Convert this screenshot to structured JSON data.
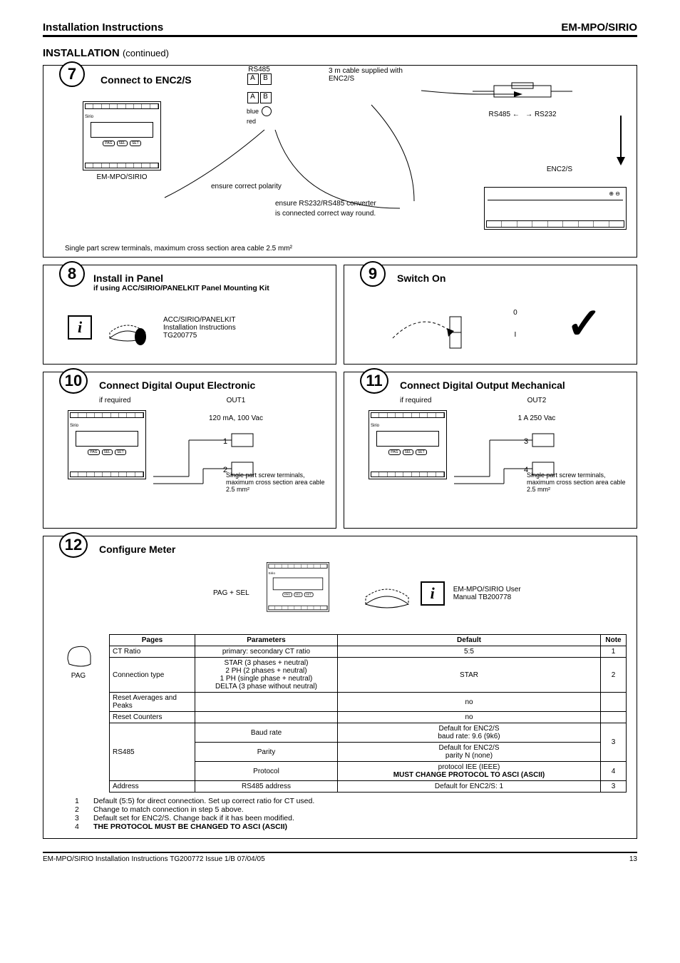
{
  "header": {
    "left": "Installation Instructions",
    "right": "EM-MPO/SIRIO"
  },
  "section": {
    "title": "INSTALLATION",
    "continued": "(continued)"
  },
  "step7": {
    "num": "7",
    "title": "Connect to ENC2/S",
    "rs485": "RS485",
    "a": "A",
    "b": "B",
    "cable": "3 m cable supplied with ENC2/S",
    "blue": "blue",
    "red": "red",
    "polarity": "ensure correct polarity",
    "converter1": "ensure RS232/RS485 converter",
    "converter2": "is connected correct way round.",
    "device": "EM-MPO/SIRIO",
    "enc": "ENC2/S",
    "left485": "RS485 ←",
    "right232": "→ RS232",
    "terminals": "Single part screw terminals, maximum cross section area cable 2.5 mm²",
    "pag": "PAG",
    "sel": "SEL",
    "set": "SET",
    "sirio": "Sirio"
  },
  "step8": {
    "num": "8",
    "title": "Install in Panel",
    "sub": "if using ACC/SIRIO/PANELKIT Panel Mounting Kit",
    "doc1": "ACC/SIRIO/PANELKIT",
    "doc2": "Installation Instructions",
    "doc3": "TG200775"
  },
  "step9": {
    "num": "9",
    "title": "Switch On",
    "zero": "0",
    "one": "I"
  },
  "step10": {
    "num": "10",
    "title": "Connect Digital Ouput Electronic",
    "ifreq": "if required",
    "out": "OUT1",
    "rating": "120 mA, 100 Vac",
    "t1": "1",
    "t2": "2",
    "note": "Single part screw terminals, maximum cross section area cable 2.5 mm²",
    "pag": "PAG",
    "sel": "SEL",
    "set": "SET",
    "sirio": "Sirio"
  },
  "step11": {
    "num": "11",
    "title": "Connect Digital Output Mechanical",
    "ifreq": "if required",
    "out": "OUT2",
    "rating": "1 A  250 Vac",
    "t3": "3",
    "t4": "4",
    "note": "Single part screw terminals, maximum cross section area cable 2.5 mm²",
    "pag": "PAG",
    "sel": "SEL",
    "set": "SET",
    "sirio": "Sirio"
  },
  "step12": {
    "num": "12",
    "title": "Configure Meter",
    "pagsel": "PAG + SEL",
    "doc1": "EM-MPO/SIRIO User",
    "doc2": "Manual TB200778",
    "paglabel": "PAG",
    "pag": "PAG",
    "sel": "SEL",
    "set": "SET",
    "sirio": "Sirio"
  },
  "table": {
    "headers": {
      "pages": "Pages",
      "params": "Parameters",
      "default": "Default",
      "note": "Note"
    },
    "rows": [
      {
        "page": "CT Ratio",
        "param": "primary: secondary CT ratio",
        "def": "5:5",
        "note": "1"
      },
      {
        "page": "Connection type",
        "param": "STAR (3 phases + neutral)\n2 PH (2 phases + neutral)\n1 PH (single phase + neutral)\nDELTA (3 phase without neutral)",
        "def": "STAR",
        "note": "2"
      },
      {
        "page": "Reset Averages and Peaks",
        "param": "",
        "def": "no",
        "note": ""
      },
      {
        "page": "Reset Counters",
        "param": "",
        "def": "no",
        "note": ""
      },
      {
        "page": "RS485",
        "param": "Baud rate",
        "def": "Default for ENC2/S\nbaud rate: 9.6 (9k6)",
        "note": "3"
      },
      {
        "page": "",
        "param": "Parity",
        "def": "Default for ENC2/S\nparity N (none)",
        "note": ""
      },
      {
        "page": "",
        "param": "Protocol",
        "def": "protocol IEE (IEEE)\nMUST CHANGE PROTOCOL TO ASCI (ASCII)",
        "note": "4"
      },
      {
        "page": "Address",
        "param": "RS485 address",
        "def": "Default for ENC2/S: 1",
        "note": "3"
      }
    ]
  },
  "footnotes": {
    "n1": "1",
    "t1": "Default (5:5) for direct connection. Set up correct ratio for CT used.",
    "n2": "2",
    "t2": "Change to match connection in step 5 above.",
    "n3": "3",
    "t3": "Default set for ENC2/S. Change back if it has been modified.",
    "n4": "4",
    "t4": "THE PROTOCOL MUST BE CHANGED TO ASCI (ASCII)"
  },
  "footer": {
    "left": "EM-MPO/SIRIO Installation Instructions TG200772 Issue 1/B 07/04/05",
    "right": "13"
  }
}
